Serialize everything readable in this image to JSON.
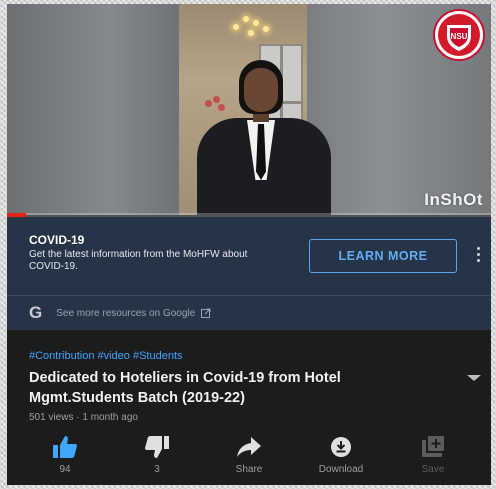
{
  "video": {
    "watermark": "InShOt",
    "logo_text": "NSU",
    "progress_fraction": 0.04,
    "accent_color": "#e62117"
  },
  "ad": {
    "title": "COVID-19",
    "description": "Get the latest information from the MoHFW about COVID-19.",
    "cta_label": "LEARN MORE",
    "google_text": "See more resources on Google",
    "google_icon": "G",
    "cta_color": "#5aa4f0",
    "panel_color": "#253447"
  },
  "info": {
    "hashtags": "#Contribution #video #Students",
    "title": "Dedicated to Hoteliers in Covid-19 from Hotel Mgmt.Students Batch (2019-22)",
    "meta": "501 views · 1 month ago"
  },
  "actions": [
    {
      "name": "like",
      "icon": "thumbs-up-icon",
      "label": "94",
      "color": "#3ea6ff"
    },
    {
      "name": "dislike",
      "icon": "thumbs-down-icon",
      "label": "3",
      "color": "#e0e0e0"
    },
    {
      "name": "share",
      "icon": "share-icon",
      "label": "Share",
      "color": "#e0e0e0"
    },
    {
      "name": "download",
      "icon": "download-icon",
      "label": "Download",
      "color": "#e0e0e0"
    },
    {
      "name": "save",
      "icon": "playlist-add-icon",
      "label": "Save",
      "color": "#5c5c5c"
    }
  ]
}
